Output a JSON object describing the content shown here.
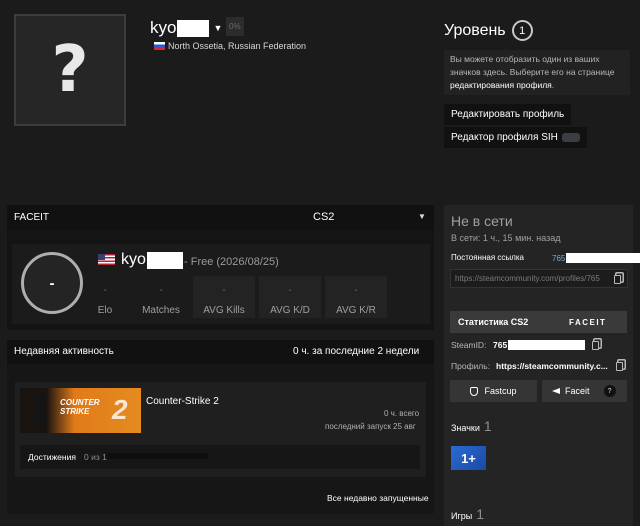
{
  "header": {
    "avatar_glyph": "?",
    "username": "kyo",
    "percent": "0%",
    "location": "North Ossetia, Russian Federation"
  },
  "level": {
    "title": "Уровень",
    "value": "1",
    "desc_text": "Вы можете отобразить один из ваших значков здесь. Выберите его на странице ",
    "desc_link": "редактирования профиля",
    "desc_end": ".",
    "edit_button": "Редактировать профиль",
    "sih_button": "Редактор профиля SIH"
  },
  "faceit": {
    "label": "FACEIT",
    "game": "CS2",
    "elo_ring": "-",
    "player_name": "kyo",
    "tier": "- Free (2026/08/25)",
    "stats": [
      {
        "label": "Elo",
        "value": "-"
      },
      {
        "label": "Matches",
        "value": "-"
      },
      {
        "label": "AVG Kills",
        "value": "-"
      },
      {
        "label": "AVG K/D",
        "value": "-"
      },
      {
        "label": "AVG K/R",
        "value": "-"
      }
    ]
  },
  "activity": {
    "title": "Недавняя активность",
    "hours": "0 ч. за последние 2 недели",
    "game_name": "Counter-Strike 2",
    "capsule_line1": "COUNTER",
    "capsule_line2": "STRIKE",
    "capsule_num": "2",
    "game_hours": "0 ч. всего",
    "game_last": "последний запуск 25 авг",
    "achievements_label": "Достижения",
    "achievements_count": "0 из 1",
    "achievements_progress": 0,
    "all_recent": "Все недавно запущенные"
  },
  "sidebar": {
    "status": "Не в сети",
    "last_online": "В сети: 1 ч., 15 мин. назад",
    "permalink_label": "Постоянная ссылка",
    "permalink_id": "765",
    "permalink_url": "https://steamcommunity.com/profiles/765",
    "stats_title": "Статистика CS2",
    "stats_logo": "FACEIT",
    "steamid_label": "SteamID:",
    "steamid_value": "765",
    "profile_label": "Профиль:",
    "profile_value": "https://steamcommunity.c...",
    "fastcup_button": "Fastcup",
    "faceit_button": "Faceit",
    "faceit_help": "?",
    "badges_label": "Значки",
    "badges_count": "1",
    "badge_text": "1+",
    "games_label": "Игры",
    "games_count": "1"
  },
  "colors": {
    "background": "#1b1b1b",
    "panel": "#242424",
    "link": "#6ab0e4",
    "badge": "#2a6bd6"
  }
}
